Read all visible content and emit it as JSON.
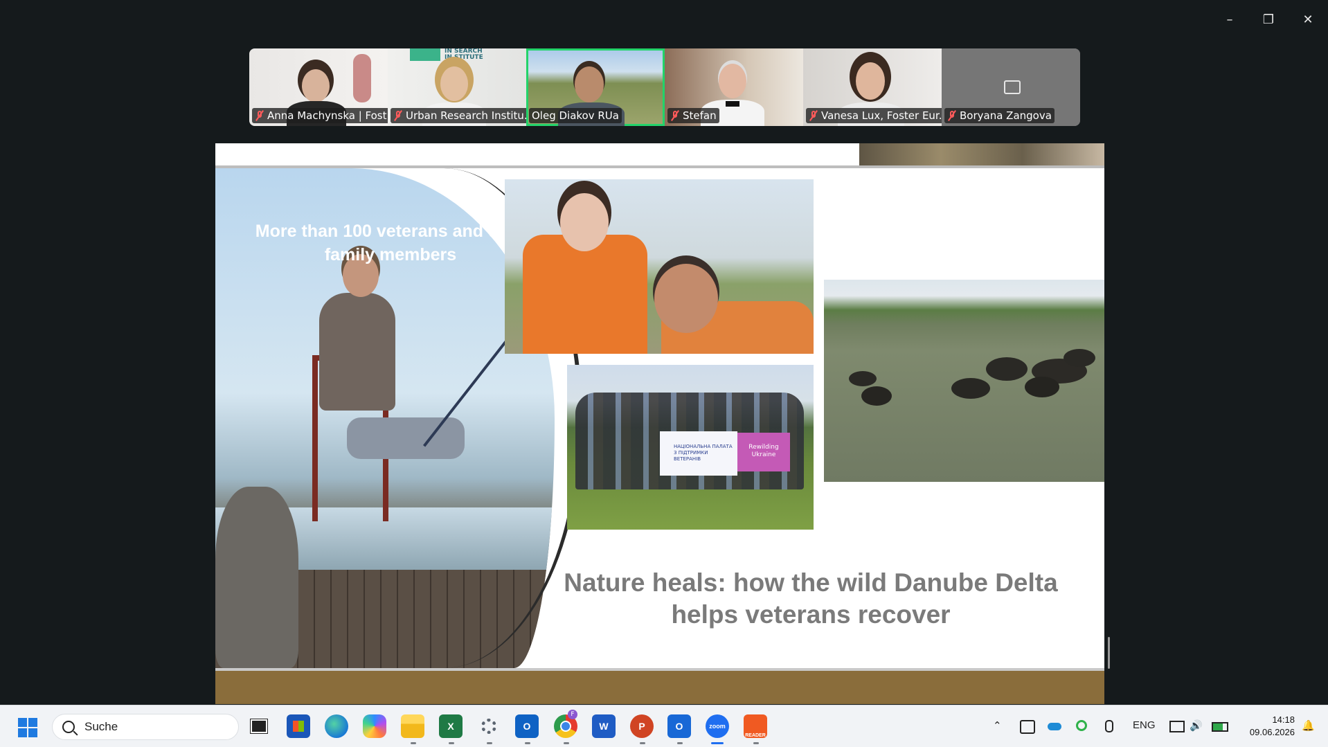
{
  "window": {
    "controls": {
      "minimize": "–",
      "restore": "❐",
      "close": "✕"
    }
  },
  "participants": [
    {
      "name": "Anna Machynska | Fost...",
      "muted": true,
      "active": false
    },
    {
      "name": "Urban Research Institu...",
      "muted": true,
      "active": false,
      "logo_text": "IN SEARCH\nIN STITUTE"
    },
    {
      "name": "Oleg Diakov RUa",
      "muted": false,
      "active": true
    },
    {
      "name": "Stefan",
      "muted": true,
      "active": false
    },
    {
      "name": "Vanesa Lux, Foster Eur...",
      "muted": true,
      "active": false
    },
    {
      "name": "Boryana Zangova",
      "muted": true,
      "active": false,
      "video_off": true
    }
  ],
  "slide": {
    "left_caption": "More than 100 veterans and their family members",
    "title": "Nature heals: how the wild Danube Delta helps veterans recover",
    "banner_left": "НАЦІОНАЛЬНА ПАЛАТА З ПІДТРИМКИ ВЕТЕРАНІВ",
    "banner_right": "Rewilding Ukraine"
  },
  "taskbar": {
    "search_placeholder": "Suche",
    "apps": [
      {
        "name": "task-view"
      },
      {
        "name": "microsoft-store"
      },
      {
        "name": "edge"
      },
      {
        "name": "copilot"
      },
      {
        "name": "file-explorer"
      },
      {
        "name": "excel",
        "label": "X"
      },
      {
        "name": "settings"
      },
      {
        "name": "outlook",
        "label": "O"
      },
      {
        "name": "chrome",
        "badge": "F"
      },
      {
        "name": "word",
        "label": "W"
      },
      {
        "name": "powerpoint",
        "label": "P"
      },
      {
        "name": "outlook-new",
        "label": "O"
      },
      {
        "name": "zoom",
        "label": "zoom"
      },
      {
        "name": "pdf-reader",
        "label": "READER"
      }
    ],
    "language": "ENG",
    "time": "14:18",
    "date": "09.06.2026"
  }
}
